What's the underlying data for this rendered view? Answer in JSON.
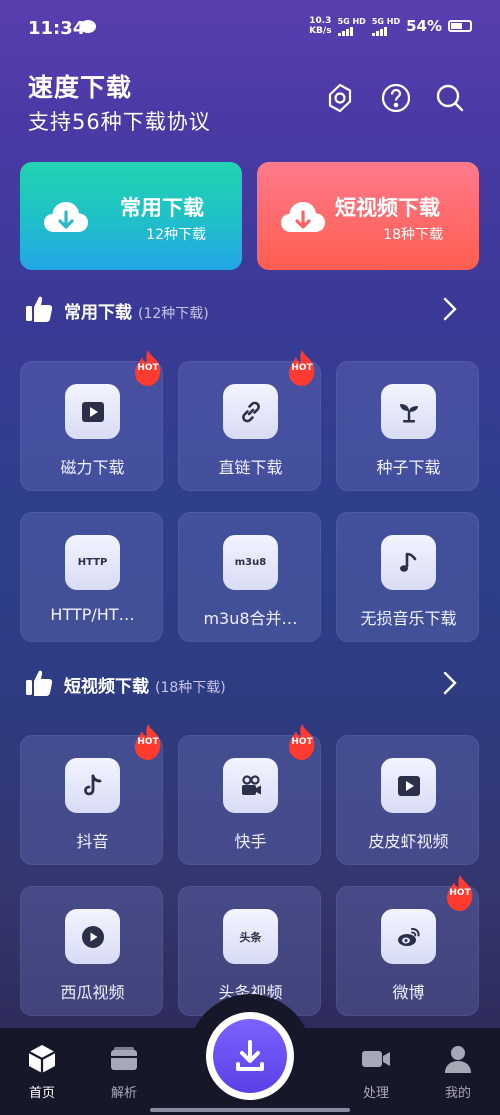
{
  "status_bar": {
    "time": "11:34",
    "net_speed_value": "10.3",
    "net_speed_unit": "KB/s",
    "sim1": "5G HD",
    "sim2": "5G HD",
    "battery": "54%"
  },
  "header": {
    "title": "速度下载",
    "subtitle": "支持56种下载协议",
    "icons": [
      "settings-icon",
      "help-icon",
      "search-icon"
    ]
  },
  "banners": [
    {
      "title": "常用下载",
      "subtitle": "12种下载",
      "color": "#22c7c0"
    },
    {
      "title": "短视频下载",
      "subtitle": "18种下载",
      "color": "#ff6b6b"
    }
  ],
  "sections": [
    {
      "title": "常用下载",
      "count": "(12种下载)",
      "items": [
        {
          "label": "磁力下载",
          "icon": "play-icon",
          "hot": true
        },
        {
          "label": "直链下载",
          "icon": "link-icon",
          "hot": true
        },
        {
          "label": "种子下载",
          "icon": "sprout-icon",
          "hot": false
        },
        {
          "label": "HTTP/HT…",
          "icon": "http-icon",
          "icon_text": "HTTP",
          "hot": false
        },
        {
          "label": "m3u8合并…",
          "icon": "m3u8-icon",
          "icon_text": "m3u8",
          "hot": false
        },
        {
          "label": "无损音乐下载",
          "icon": "music-note-icon",
          "hot": false
        }
      ]
    },
    {
      "title": "短视频下载",
      "count": "(18种下载)",
      "items": [
        {
          "label": "抖音",
          "icon": "douyin-icon",
          "hot": true
        },
        {
          "label": "快手",
          "icon": "kuaishou-icon",
          "hot": true
        },
        {
          "label": "皮皮虾视频",
          "icon": "play-icon",
          "hot": false
        },
        {
          "label": "西瓜视频",
          "icon": "xigua-icon",
          "hot": false
        },
        {
          "label": "头条视频",
          "icon": "toutiao-icon",
          "icon_text": "头条",
          "hot": false
        },
        {
          "label": "微博",
          "icon": "weibo-icon",
          "hot": true
        }
      ]
    }
  ],
  "hot_badge": "HOT",
  "bottom_nav": [
    {
      "label": "首页",
      "icon": "home-cube-icon",
      "active": true
    },
    {
      "label": "解析",
      "icon": "folder-icon",
      "active": false
    },
    {
      "label": "处理",
      "icon": "video-camera-icon",
      "active": false
    },
    {
      "label": "我的",
      "icon": "user-icon",
      "active": false
    }
  ],
  "colors": {
    "accent": "#6a4ff0",
    "hot": "#ff3b30",
    "nav_bg": "#17172a"
  }
}
